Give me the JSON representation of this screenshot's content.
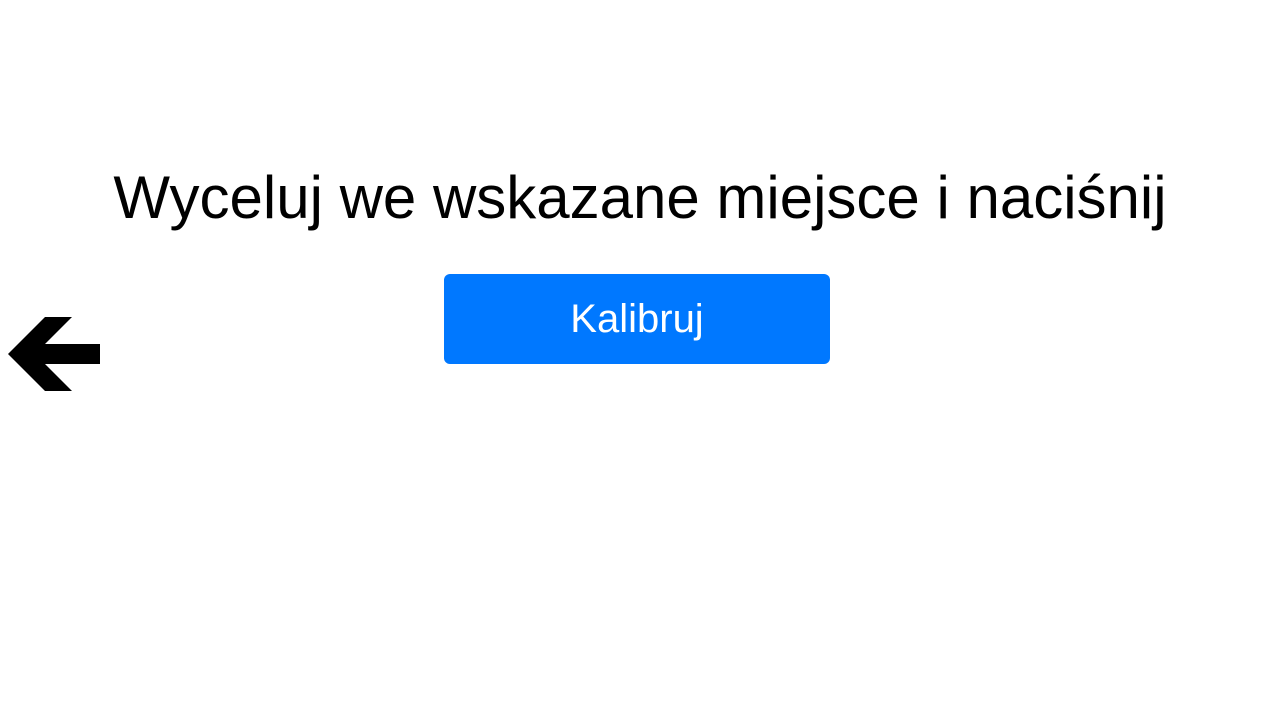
{
  "instruction": {
    "text": "Wyceluj we wskazane miejsce i naciśnij"
  },
  "calibrate_button": {
    "label": "Kalibruj",
    "color": "#0078FF"
  },
  "back_button": {
    "icon": "arrow-left-icon"
  }
}
